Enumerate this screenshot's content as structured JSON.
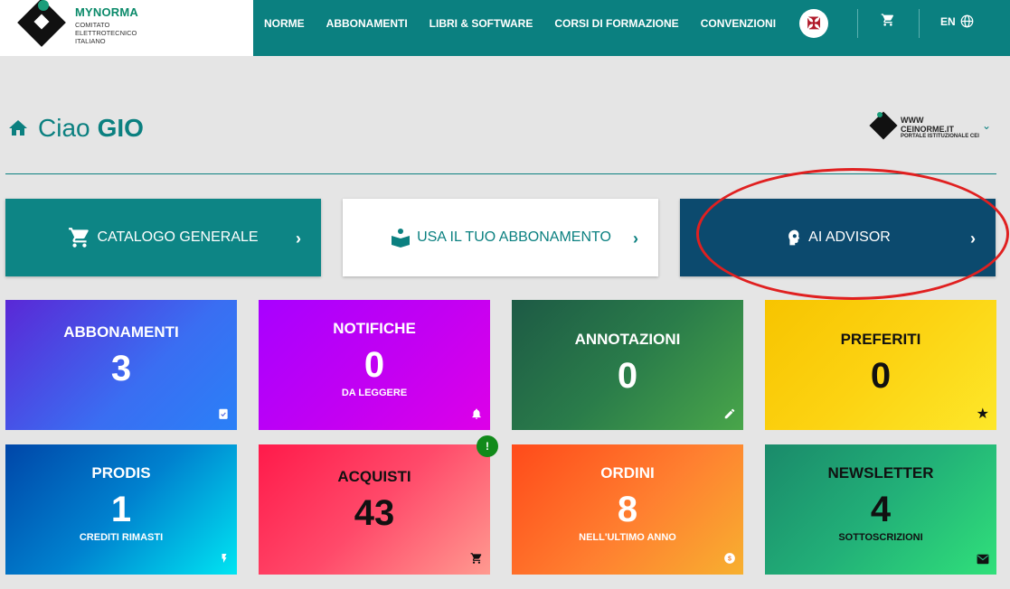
{
  "brand": {
    "name": "MYNORMA",
    "sub": "COMITATO ELETTROTECNICO ITALIANO"
  },
  "nav": [
    "NORME",
    "ABBONAMENTI",
    "LIBRI & SOFTWARE",
    "CORSI DI FORMAZIONE",
    "CONVENZIONI"
  ],
  "header": {
    "lang": "EN"
  },
  "greeting": {
    "hello": "Ciao",
    "name": "GIO"
  },
  "portal": {
    "line1": "WWW",
    "line2": "CEINORME.IT",
    "line3": "PORTALE ISTITUZIONALE CEI"
  },
  "actions": [
    {
      "label": "CATALOGO GENERALE"
    },
    {
      "label": "USA IL TUO ABBONAMENTO"
    },
    {
      "label": "AI ADVISOR"
    }
  ],
  "tiles": {
    "abbonamenti": {
      "title": "ABBONAMENTI",
      "value": "3"
    },
    "notifiche": {
      "title": "NOTIFICHE",
      "value": "0",
      "sub": "DA LEGGERE"
    },
    "annotazioni": {
      "title": "ANNOTAZIONI",
      "value": "0"
    },
    "preferiti": {
      "title": "PREFERITI",
      "value": "0"
    },
    "prodis": {
      "title": "PRODIS",
      "value": "1",
      "sub": "CREDITI RIMASTI"
    },
    "acquisti": {
      "title": "ACQUISTI",
      "value": "43",
      "badge": "!"
    },
    "ordini": {
      "title": "ORDINI",
      "value": "8",
      "sub": "NELL'ULTIMO ANNO"
    },
    "newsletter": {
      "title": "NEWSLETTER",
      "value": "4",
      "sub": "SOTTOSCRIZIONI"
    }
  },
  "colors": {
    "primary": "#0b8080",
    "advisor": "#0c4a6e",
    "annotation": "#e02020"
  }
}
